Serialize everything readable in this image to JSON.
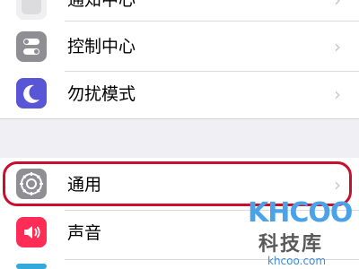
{
  "settings": {
    "rows": [
      {
        "label": "通知中心",
        "icon": "notification-center-icon",
        "color": "#ff3b30"
      },
      {
        "label": "控制中心",
        "icon": "control-center-icon",
        "color": "#8e8e93"
      },
      {
        "label": "勿扰模式",
        "icon": "do-not-disturb-moon-icon",
        "color": "#5856d6"
      },
      {
        "label": "通用",
        "icon": "gear-icon",
        "color": "#8e8e93"
      },
      {
        "label": "声音",
        "icon": "speaker-icon",
        "color": "#ff2d55"
      }
    ],
    "chevron": "›"
  },
  "watermark": {
    "logo": "KHCOO",
    "brand": "科技库",
    "url": "khcoo.com"
  }
}
